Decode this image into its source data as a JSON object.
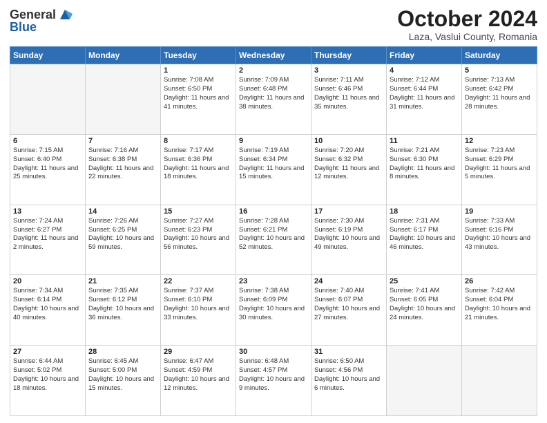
{
  "logo": {
    "general": "General",
    "blue": "Blue"
  },
  "title": {
    "month": "October 2024",
    "location": "Laza, Vaslui County, Romania"
  },
  "days_header": [
    "Sunday",
    "Monday",
    "Tuesday",
    "Wednesday",
    "Thursday",
    "Friday",
    "Saturday"
  ],
  "weeks": [
    [
      {
        "day": "",
        "info": ""
      },
      {
        "day": "",
        "info": ""
      },
      {
        "day": "1",
        "info": "Sunrise: 7:08 AM\nSunset: 6:50 PM\nDaylight: 11 hours and 41 minutes."
      },
      {
        "day": "2",
        "info": "Sunrise: 7:09 AM\nSunset: 6:48 PM\nDaylight: 11 hours and 38 minutes."
      },
      {
        "day": "3",
        "info": "Sunrise: 7:11 AM\nSunset: 6:46 PM\nDaylight: 11 hours and 35 minutes."
      },
      {
        "day": "4",
        "info": "Sunrise: 7:12 AM\nSunset: 6:44 PM\nDaylight: 11 hours and 31 minutes."
      },
      {
        "day": "5",
        "info": "Sunrise: 7:13 AM\nSunset: 6:42 PM\nDaylight: 11 hours and 28 minutes."
      }
    ],
    [
      {
        "day": "6",
        "info": "Sunrise: 7:15 AM\nSunset: 6:40 PM\nDaylight: 11 hours and 25 minutes."
      },
      {
        "day": "7",
        "info": "Sunrise: 7:16 AM\nSunset: 6:38 PM\nDaylight: 11 hours and 22 minutes."
      },
      {
        "day": "8",
        "info": "Sunrise: 7:17 AM\nSunset: 6:36 PM\nDaylight: 11 hours and 18 minutes."
      },
      {
        "day": "9",
        "info": "Sunrise: 7:19 AM\nSunset: 6:34 PM\nDaylight: 11 hours and 15 minutes."
      },
      {
        "day": "10",
        "info": "Sunrise: 7:20 AM\nSunset: 6:32 PM\nDaylight: 11 hours and 12 minutes."
      },
      {
        "day": "11",
        "info": "Sunrise: 7:21 AM\nSunset: 6:30 PM\nDaylight: 11 hours and 8 minutes."
      },
      {
        "day": "12",
        "info": "Sunrise: 7:23 AM\nSunset: 6:29 PM\nDaylight: 11 hours and 5 minutes."
      }
    ],
    [
      {
        "day": "13",
        "info": "Sunrise: 7:24 AM\nSunset: 6:27 PM\nDaylight: 11 hours and 2 minutes."
      },
      {
        "day": "14",
        "info": "Sunrise: 7:26 AM\nSunset: 6:25 PM\nDaylight: 10 hours and 59 minutes."
      },
      {
        "day": "15",
        "info": "Sunrise: 7:27 AM\nSunset: 6:23 PM\nDaylight: 10 hours and 56 minutes."
      },
      {
        "day": "16",
        "info": "Sunrise: 7:28 AM\nSunset: 6:21 PM\nDaylight: 10 hours and 52 minutes."
      },
      {
        "day": "17",
        "info": "Sunrise: 7:30 AM\nSunset: 6:19 PM\nDaylight: 10 hours and 49 minutes."
      },
      {
        "day": "18",
        "info": "Sunrise: 7:31 AM\nSunset: 6:17 PM\nDaylight: 10 hours and 46 minutes."
      },
      {
        "day": "19",
        "info": "Sunrise: 7:33 AM\nSunset: 6:16 PM\nDaylight: 10 hours and 43 minutes."
      }
    ],
    [
      {
        "day": "20",
        "info": "Sunrise: 7:34 AM\nSunset: 6:14 PM\nDaylight: 10 hours and 40 minutes."
      },
      {
        "day": "21",
        "info": "Sunrise: 7:35 AM\nSunset: 6:12 PM\nDaylight: 10 hours and 36 minutes."
      },
      {
        "day": "22",
        "info": "Sunrise: 7:37 AM\nSunset: 6:10 PM\nDaylight: 10 hours and 33 minutes."
      },
      {
        "day": "23",
        "info": "Sunrise: 7:38 AM\nSunset: 6:09 PM\nDaylight: 10 hours and 30 minutes."
      },
      {
        "day": "24",
        "info": "Sunrise: 7:40 AM\nSunset: 6:07 PM\nDaylight: 10 hours and 27 minutes."
      },
      {
        "day": "25",
        "info": "Sunrise: 7:41 AM\nSunset: 6:05 PM\nDaylight: 10 hours and 24 minutes."
      },
      {
        "day": "26",
        "info": "Sunrise: 7:42 AM\nSunset: 6:04 PM\nDaylight: 10 hours and 21 minutes."
      }
    ],
    [
      {
        "day": "27",
        "info": "Sunrise: 6:44 AM\nSunset: 5:02 PM\nDaylight: 10 hours and 18 minutes."
      },
      {
        "day": "28",
        "info": "Sunrise: 6:45 AM\nSunset: 5:00 PM\nDaylight: 10 hours and 15 minutes."
      },
      {
        "day": "29",
        "info": "Sunrise: 6:47 AM\nSunset: 4:59 PM\nDaylight: 10 hours and 12 minutes."
      },
      {
        "day": "30",
        "info": "Sunrise: 6:48 AM\nSunset: 4:57 PM\nDaylight: 10 hours and 9 minutes."
      },
      {
        "day": "31",
        "info": "Sunrise: 6:50 AM\nSunset: 4:56 PM\nDaylight: 10 hours and 6 minutes."
      },
      {
        "day": "",
        "info": ""
      },
      {
        "day": "",
        "info": ""
      }
    ]
  ]
}
